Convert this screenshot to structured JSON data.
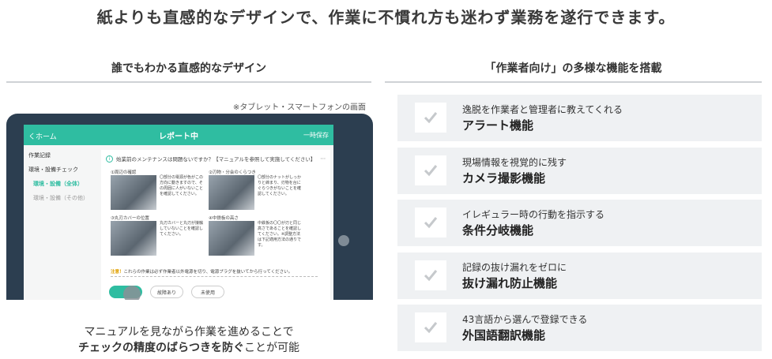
{
  "headline": "紙よりも直感的なデザインで、作業に不慣れ方も迷わず業務を遂行できます。",
  "left": {
    "title": "誰でもわかる直感的なデザイン",
    "note": "※タブレット・スマートフォンの画面",
    "caption_line1": "マニュアルを見ながら作業を進めることで",
    "caption_line2_bold": "チェックの精度のばらつきを防ぐ",
    "caption_line2_rest": "ことが可能"
  },
  "tablet": {
    "back": "くホーム",
    "title": "レポート中",
    "save": "一時保存",
    "sidebar": [
      "作業記録",
      "環境・設備チェック",
      "環境・設備（全体）",
      "環境・設備（その他）"
    ],
    "question": "始業前のメンテナンスは問題ないですか？【マニュアルを参照して実施してください】",
    "steps": [
      {
        "cap": "①周辺の確認",
        "desc": "〇部分の電源が色がこの方向に動きますので、その周囲に人がいないことを確認してください。"
      },
      {
        "cap": "②刃物・分会のくらつき",
        "desc": "〇部分のナットがしっかりと締まり、刃物を台にぐらつきがないことを確認してください。"
      },
      {
        "cap": "③丸刃カバーの位置",
        "desc": "丸刃カバーと丸刃が接触していないことを確認してください。"
      },
      {
        "cap": "④中鉄板の高さ",
        "desc": "中鉄板の〇〇が刃と同じ高さであることを確認してください。※調整方法は下記適用方法の通りです。"
      }
    ],
    "warning_label": "注意！",
    "warning": "これらの作業は必ず作業者以外電源を切り、電源プラグを抜いてから行ってください。",
    "buttons": [
      "",
      "故障あり",
      "未使用"
    ]
  },
  "right": {
    "title": "「作業者向け」の多様な機能を搭載",
    "features": [
      {
        "sub": "逸脱を作業者と管理者に教えてくれる",
        "main": "アラート機能"
      },
      {
        "sub": "現場情報を視覚的に残す",
        "main": "カメラ撮影機能"
      },
      {
        "sub": "イレギュラー時の行動を指示する",
        "main": "条件分岐機能"
      },
      {
        "sub": "記録の抜け漏れをゼロに",
        "main": "抜け漏れ防止機能"
      },
      {
        "sub": "43言語から選んで登録できる",
        "main": "外国語翻訳機能"
      }
    ]
  },
  "colors": {
    "accent": "#2fbda1",
    "tablet_frame": "#2c3e50",
    "feature_bg": "#eff1f3"
  }
}
